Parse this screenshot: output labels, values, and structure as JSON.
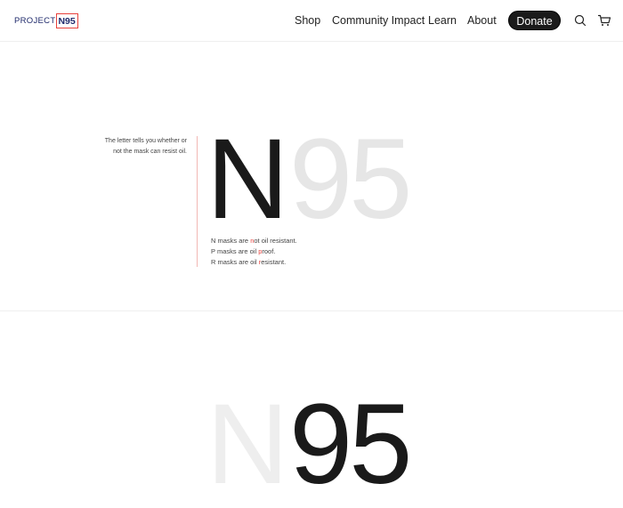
{
  "header": {
    "logo": {
      "project": "PROJECT",
      "n95": "N95"
    },
    "nav": [
      {
        "label": "Shop"
      },
      {
        "label": "Community Impact"
      },
      {
        "label": "Learn"
      },
      {
        "label": "About"
      }
    ],
    "donate_label": "Donate",
    "icons": {
      "search": "search-icon",
      "cart": "cart-icon"
    }
  },
  "hero": {
    "side_note_line1": "The letter tells you whether or",
    "side_note_line2": "not the mask can resist oil.",
    "letter": "N",
    "digits": "95",
    "mask_lines": [
      {
        "pre": "N masks are ",
        "hl": "n",
        "post": "ot oil resistant."
      },
      {
        "pre": "P masks are oil ",
        "hl": "p",
        "post": "roof."
      },
      {
        "pre": "R masks are oil ",
        "hl": "r",
        "post": "esistant."
      }
    ]
  },
  "section2": {
    "letter": "N",
    "digits": "95"
  },
  "colors": {
    "accent_red": "#e8413b",
    "brand_navy": "#1f2a6b",
    "donate_bg": "#1b1b1b",
    "faded_digits": "#e6e6e6"
  }
}
